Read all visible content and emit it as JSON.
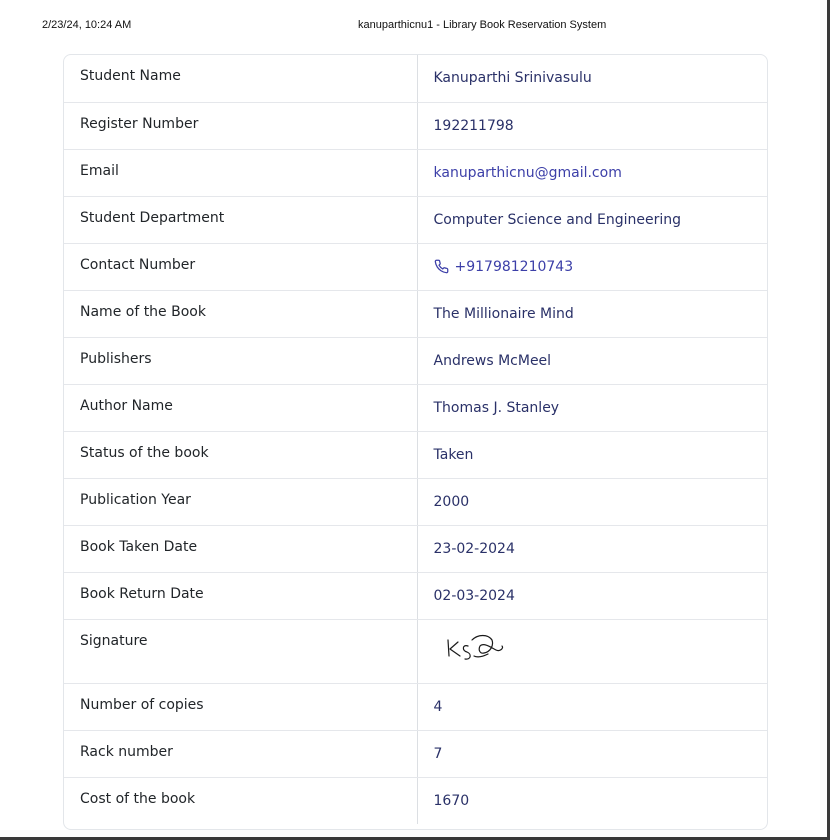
{
  "print_header": {
    "datetime": "2/23/24, 10:24 AM",
    "title": "kanuparthicnu1 - Library Book Reservation System"
  },
  "details": {
    "student_name": {
      "label": "Student Name",
      "value": "Kanuparthi Srinivasulu"
    },
    "register_number": {
      "label": "Register Number",
      "value": "192211798"
    },
    "email": {
      "label": "Email",
      "value": "kanuparthicnu@gmail.com"
    },
    "department": {
      "label": "Student Department",
      "value": "Computer Science and Engineering"
    },
    "contact": {
      "label": "Contact Number",
      "value": "+917981210743",
      "icon": "phone-icon"
    },
    "book_name": {
      "label": "Name of the Book",
      "value": "The Millionaire Mind"
    },
    "publishers": {
      "label": "Publishers",
      "value": "Andrews McMeel"
    },
    "author": {
      "label": "Author Name",
      "value": "Thomas J. Stanley"
    },
    "status": {
      "label": "Status of the book",
      "value": "Taken"
    },
    "publication_year": {
      "label": "Publication Year",
      "value": "2000"
    },
    "taken_date": {
      "label": "Book Taken Date",
      "value": "23-02-2024"
    },
    "return_date": {
      "label": "Book Return Date",
      "value": "02-03-2024"
    },
    "signature": {
      "label": "Signature"
    },
    "copies": {
      "label": "Number of copies",
      "value": "4"
    },
    "rack": {
      "label": "Rack number",
      "value": "7"
    },
    "cost": {
      "label": "Cost of the book",
      "value": "1670"
    }
  },
  "colors": {
    "label_text": "#212529",
    "value_text": "#2a3168",
    "link_text": "#3c3fa8",
    "border": "#e5e7eb"
  }
}
